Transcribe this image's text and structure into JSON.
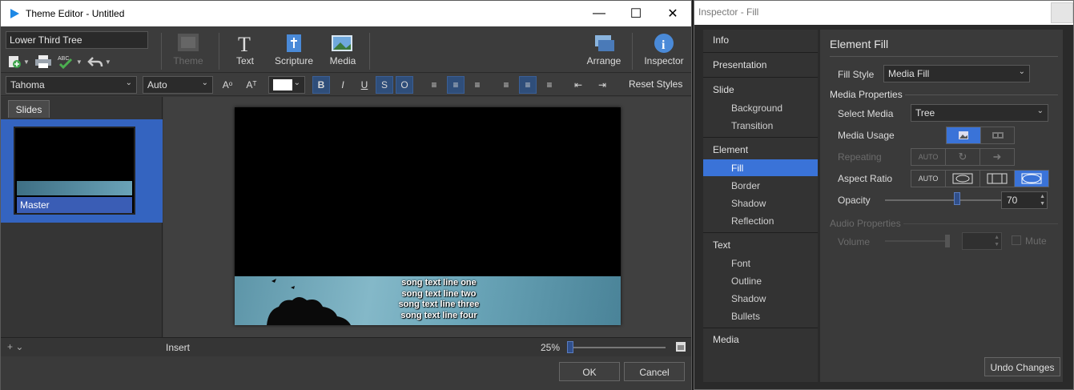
{
  "theme_editor": {
    "window_title": "Theme Editor - Untitled",
    "theme_name": "Lower Third Tree",
    "toolbar": {
      "theme_label": "Theme",
      "text_label": "Text",
      "scripture_label": "Scripture",
      "media_label": "Media",
      "arrange_label": "Arrange",
      "inspector_label": "Inspector"
    },
    "format": {
      "font": "Tahoma",
      "size": "Auto",
      "reset_styles": "Reset Styles"
    },
    "slides_tab": "Slides",
    "slides": [
      {
        "label": "Master"
      }
    ],
    "song_lines": [
      "song text line one",
      "song text line two",
      "song text line three",
      "song text line four"
    ],
    "status": {
      "insert": "Insert",
      "zoom": "25%",
      "zoom_level": 0.0
    },
    "buttons": {
      "ok": "OK",
      "cancel": "Cancel"
    }
  },
  "inspector": {
    "window_title": "Inspector - Fill",
    "nav": {
      "info": "Info",
      "presentation": "Presentation",
      "slide": "Slide",
      "slide_items": [
        "Background",
        "Transition"
      ],
      "element": "Element",
      "element_items": [
        "Fill",
        "Border",
        "Shadow",
        "Reflection"
      ],
      "selected": "Fill",
      "text": "Text",
      "text_items": [
        "Font",
        "Outline",
        "Shadow",
        "Bullets"
      ],
      "media": "Media"
    },
    "panel": {
      "title": "Element Fill",
      "fill_style_label": "Fill Style",
      "fill_style_value": "Media Fill",
      "media_properties": "Media Properties",
      "select_media_label": "Select Media",
      "select_media_value": "Tree",
      "media_usage_label": "Media Usage",
      "repeating_label": "Repeating",
      "repeating_auto": "AUTO",
      "aspect_ratio_label": "Aspect Ratio",
      "aspect_auto": "AUTO",
      "opacity_label": "Opacity",
      "opacity_value": "70",
      "audio_properties": "Audio Properties",
      "volume_label": "Volume",
      "mute_label": "Mute",
      "undo_changes": "Undo Changes"
    }
  },
  "colors": {
    "accent": "#3a73d8",
    "panel": "#3a3a3a",
    "canvas_bg": "#000000"
  }
}
